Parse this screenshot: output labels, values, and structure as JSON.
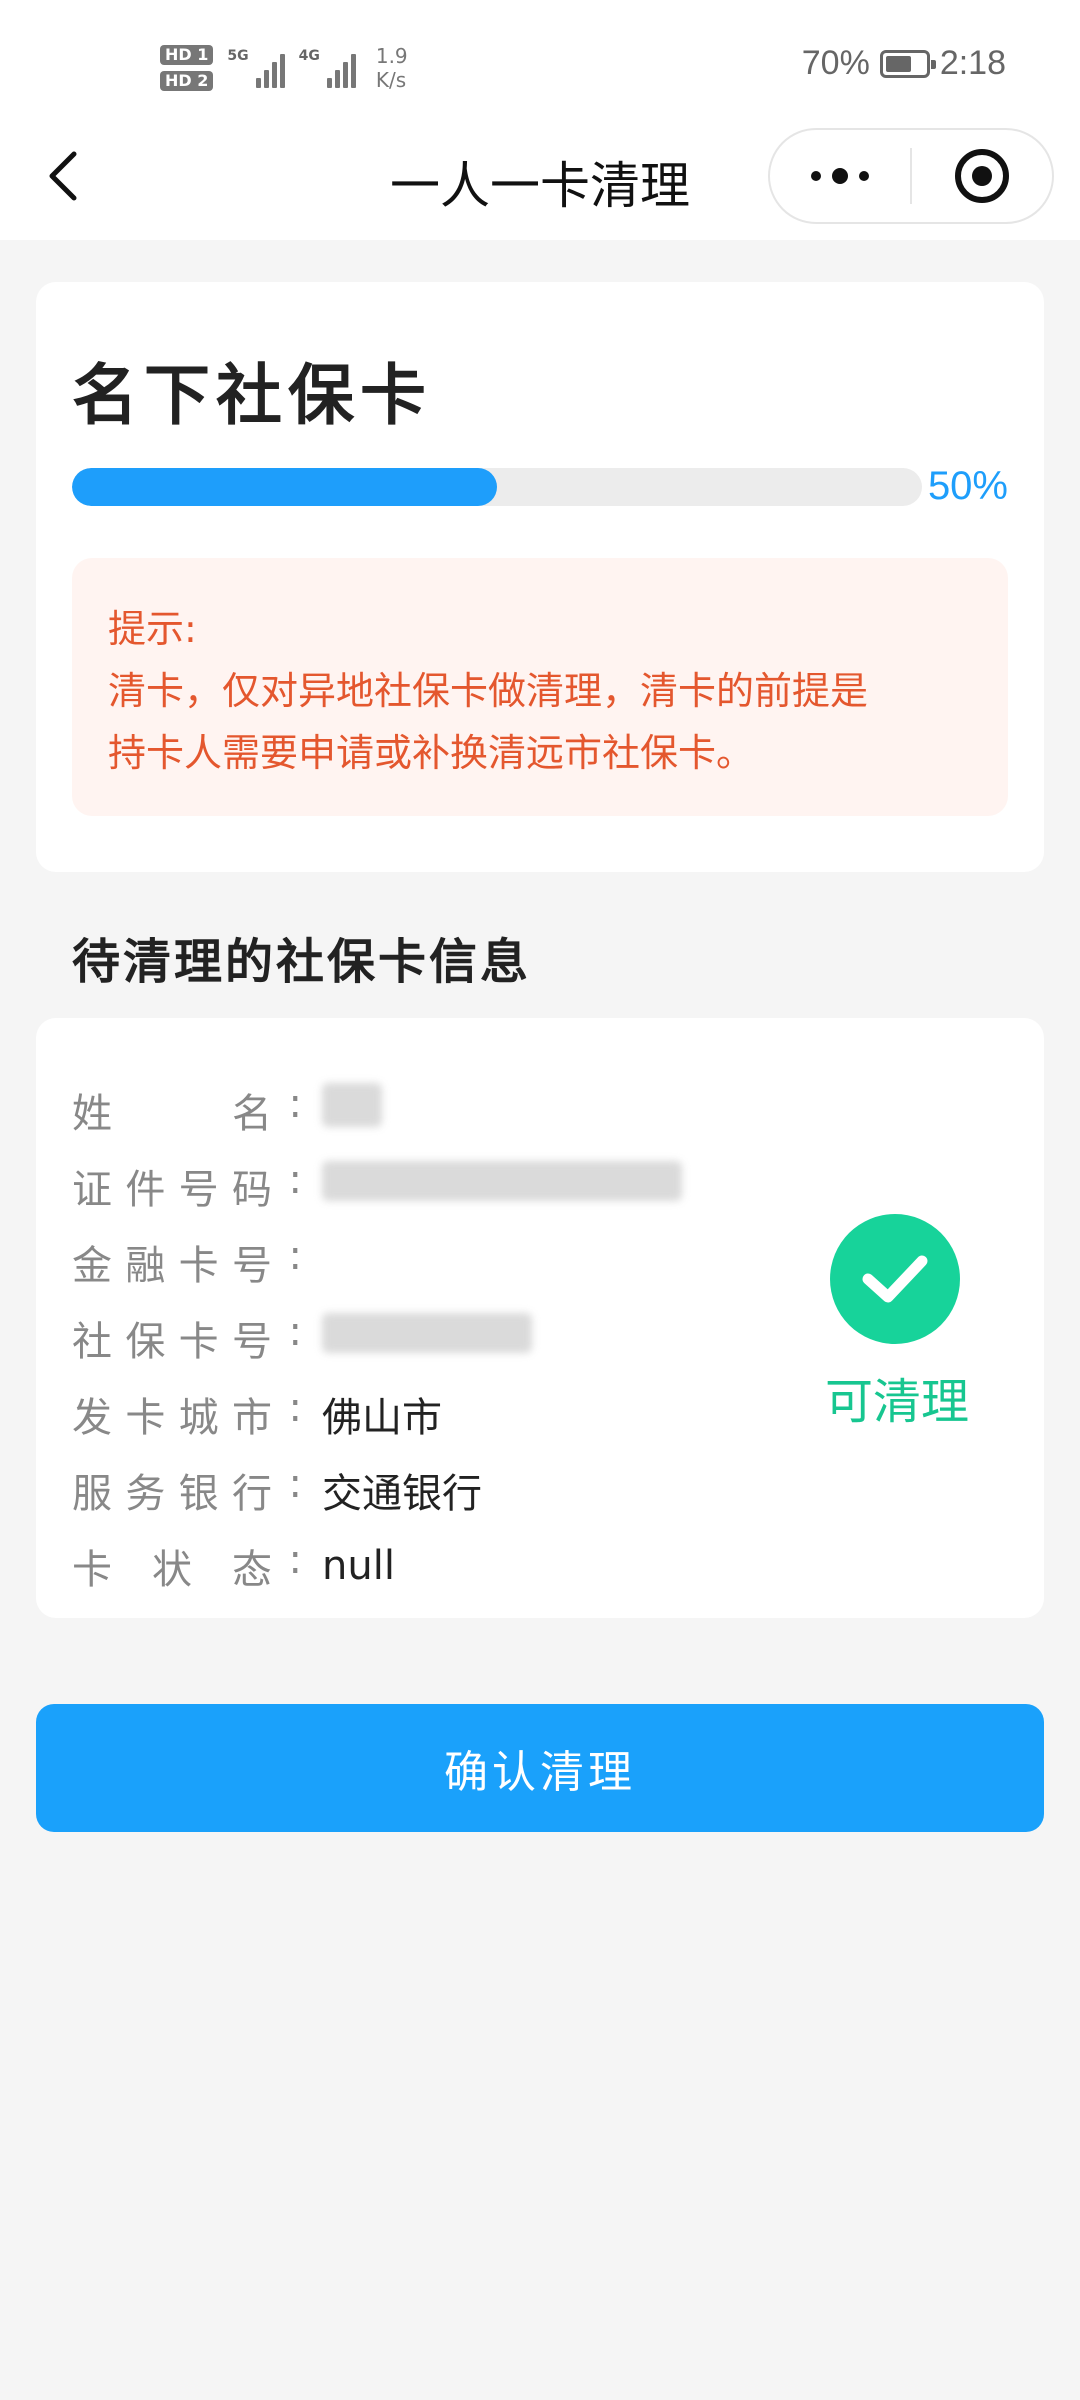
{
  "status_bar": {
    "hd1": "HD 1",
    "hd2": "HD 2",
    "net1": "5G",
    "net2": "4G",
    "speed_value": "1.9",
    "speed_unit": "K/s",
    "battery": "70%",
    "battery_level": 0.7,
    "time": "2:18"
  },
  "nav": {
    "title": "一人一卡清理",
    "back_icon": "chevron-left-icon",
    "more_icon": "more-dots-icon",
    "close_icon": "target-circle-icon"
  },
  "progress_card": {
    "title": "名下社保卡",
    "progress_value": 0.5,
    "progress_text": "50%",
    "tip_title": "提示:",
    "tip_line1": "清卡，仅对异地社保卡做清理，清卡的前提是",
    "tip_line2": "持卡人需要申请或补换清远市社保卡。"
  },
  "section_title": "待清理的社保卡信息",
  "info": {
    "rows": [
      {
        "label": "姓名",
        "value": ""
      },
      {
        "label": "证件号码",
        "value": ""
      },
      {
        "label": "金融卡号",
        "value": ""
      },
      {
        "label": "社保卡号",
        "value": ""
      },
      {
        "label": "发卡城市",
        "value": "佛山市"
      },
      {
        "label": "服务银行",
        "value": "交通银行"
      },
      {
        "label": "卡状态",
        "value": "null"
      }
    ],
    "status_text": "可清理",
    "status_icon": "check-circle-icon",
    "status_color": "#17d39a"
  },
  "confirm_button": "确认清理",
  "colors": {
    "accent": "#1e9efb",
    "tip_text": "#e4572e",
    "tip_bg": "#fff4f1"
  }
}
